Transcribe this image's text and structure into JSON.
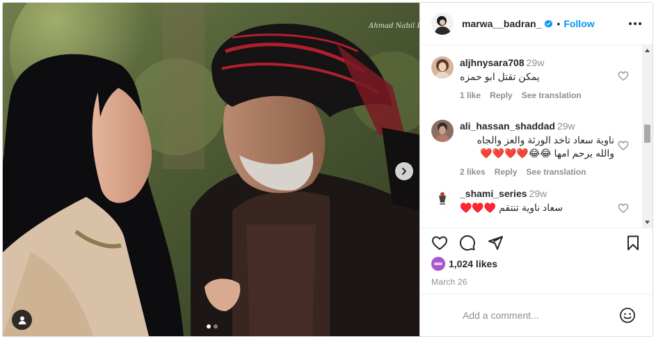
{
  "media": {
    "watermark": "Ahmad Nabil  Photography",
    "dots": 2,
    "active_dot": 0
  },
  "header": {
    "username": "marwa__badran_",
    "separator": "•",
    "follow_label": "Follow",
    "verified_color": "#0095f6"
  },
  "comments": [
    {
      "user": "aljhnysara708",
      "time": "29w",
      "text": "يمكن تقتل ابو حمزه",
      "likes": "1 like",
      "reply": "Reply",
      "translate": "See translation"
    },
    {
      "user": "ali_hassan_shaddad",
      "time": "29w",
      "text_line1": "ناوية سعاد تاخد الورثة والعز والجاه",
      "text_line2": "والله يرحم امها 😂😂❤️❤️❤️❤️",
      "likes": "2 likes",
      "reply": "Reply",
      "translate": "See translation"
    },
    {
      "user": "_shami_series",
      "time": "29w",
      "text": "سعاد ناوية تنتقم ♥️♥️♥️"
    }
  ],
  "actions": {
    "like_icon": "heart-icon",
    "comment_icon": "comment-icon",
    "share_icon": "paper-plane-icon",
    "save_icon": "bookmark-icon"
  },
  "likes": {
    "count": "1,024 likes"
  },
  "date": "March 26",
  "add_comment": {
    "placeholder": "Add a comment..."
  },
  "colors": {
    "accent": "#0095f6",
    "text": "#262626",
    "muted": "#8e8e8e",
    "border": "#dbdbdb"
  }
}
